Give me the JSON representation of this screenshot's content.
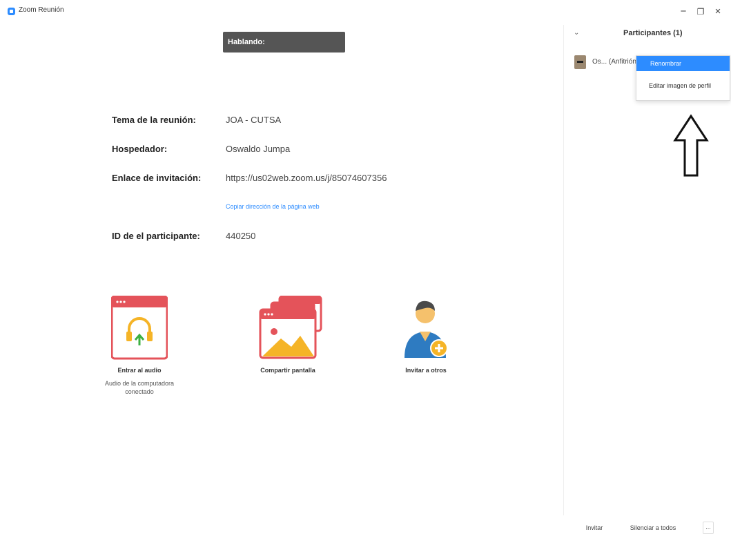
{
  "window": {
    "title": "Zoom Reunión",
    "minimize_label": "−",
    "restore_label": "❐",
    "close_label": "×"
  },
  "speaking": {
    "label": "Hablando:"
  },
  "meeting_info": {
    "topic_label": "Tema de la reunión:",
    "topic_value": "JOA - CUTSA",
    "host_label": "Hospedador:",
    "host_value": "Oswaldo Jumpa",
    "invite_label": "Enlace de invitación:",
    "invite_value": "https://us02web.zoom.us/j/85074607356",
    "copy_link_label": "Copiar dirección de la página web",
    "participant_id_label": "ID de el participante:",
    "participant_id_value": "440250"
  },
  "actions": {
    "audio_label": "Entrar al audio",
    "audio_status": "Audio de la computadora conectado",
    "share_label": "Compartir pantalla",
    "invite_label": "Invitar a otros"
  },
  "participants": {
    "title": "Participantes (1)",
    "collapse_icon": "chevron-down-icon",
    "items": [
      {
        "name": "Os... (Anfitrión, yo)"
      }
    ]
  },
  "context_menu": {
    "items": [
      {
        "label": "Renombrar"
      },
      {
        "label": "Editar imagen de perfil"
      }
    ]
  },
  "footer": {
    "invite_label": "Invitar",
    "mute_all_label": "Silenciar a todos",
    "more_label": "..."
  },
  "colors": {
    "accent": "#2d8cff",
    "speaking_bg": "#555555",
    "icon_red": "#e4535a",
    "icon_yellow": "#f5b427",
    "avatar_blue": "#2e7bc1"
  }
}
